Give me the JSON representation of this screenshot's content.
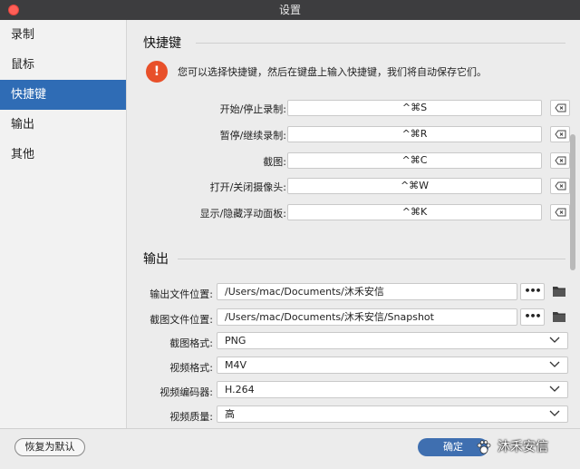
{
  "window": {
    "title": "设置"
  },
  "sidebar": {
    "items": [
      {
        "label": "录制",
        "active": false
      },
      {
        "label": "鼠标",
        "active": false
      },
      {
        "label": "快捷键",
        "active": true
      },
      {
        "label": "输出",
        "active": false
      },
      {
        "label": "其他",
        "active": false
      }
    ]
  },
  "shortcuts": {
    "title": "快捷键",
    "info": "您可以选择快捷键，然后在键盘上输入快捷键，我们将自动保存它们。",
    "info_icon": "!",
    "rows": [
      {
        "label": "开始/停止录制:",
        "value": "^⌘S"
      },
      {
        "label": "暂停/继续录制:",
        "value": "^⌘R"
      },
      {
        "label": "截图:",
        "value": "^⌘C"
      },
      {
        "label": "打开/关闭摄像头:",
        "value": "^⌘W"
      },
      {
        "label": "显示/隐藏浮动面板:",
        "value": "^⌘K"
      }
    ]
  },
  "output": {
    "title": "输出",
    "browse_label": "•••",
    "output_path": {
      "label": "输出文件位置:",
      "value": "/Users/mac/Documents/沐禾安信"
    },
    "snapshot_path": {
      "label": "截图文件位置:",
      "value": "/Users/mac/Documents/沐禾安信/Snapshot"
    },
    "screenshot_format": {
      "label": "截图格式:",
      "value": "PNG"
    },
    "video_format": {
      "label": "视频格式:",
      "value": "M4V"
    },
    "video_encoder": {
      "label": "视频编码器:",
      "value": "H.264"
    },
    "video_quality": {
      "label": "视频质量:",
      "value": "高"
    }
  },
  "footer": {
    "reset_label": "恢复为默认",
    "ok_label": "确定",
    "watermark": "沐禾安信"
  },
  "colors": {
    "accent": "#2f6cb5",
    "info": "#e8502a",
    "ok_button": "#3f6fb0"
  }
}
